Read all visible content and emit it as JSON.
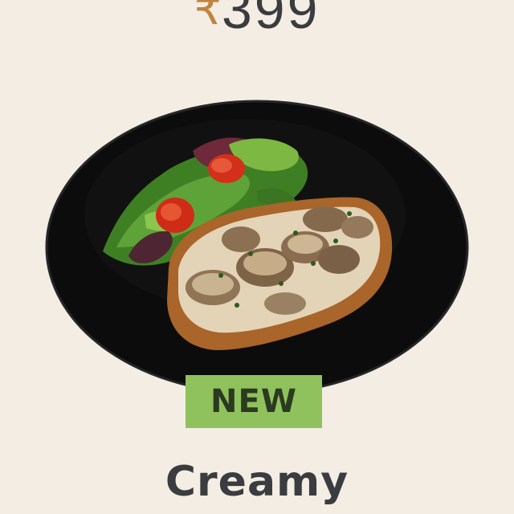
{
  "price": {
    "currency": "₹",
    "amount": "399"
  },
  "badge": {
    "label": "NEW"
  },
  "product": {
    "title": "Creamy",
    "image_icon": "mushroom-toast-plate-icon"
  },
  "colors": {
    "background": "#f3ede4",
    "price_currency": "#c0843f",
    "text_dark": "#3a3c3f",
    "badge_bg": "#8fc25d",
    "plate": "#111111"
  }
}
